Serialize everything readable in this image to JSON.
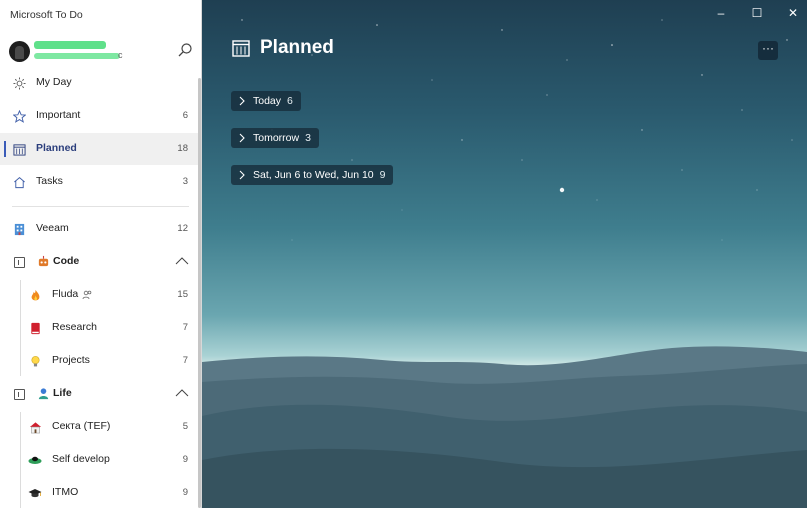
{
  "app": {
    "title": "Microsoft To Do"
  },
  "account": {
    "email_tail": "c"
  },
  "smart_lists": [
    {
      "label": "My Day",
      "count": ""
    },
    {
      "label": "Important",
      "count": "6"
    },
    {
      "label": "Planned",
      "count": "18"
    },
    {
      "label": "Tasks",
      "count": "3"
    }
  ],
  "lists": {
    "veeam": {
      "label": "Veeam",
      "count": "12"
    },
    "code_group": {
      "label": "Code"
    },
    "fluda": {
      "label": "Fluda",
      "count": "15"
    },
    "research": {
      "label": "Research",
      "count": "7"
    },
    "projects": {
      "label": "Projects",
      "count": "7"
    },
    "life_group": {
      "label": "Life"
    },
    "sekta": {
      "label": "Секта (TEF)",
      "count": "5"
    },
    "self_develop": {
      "label": "Self develop",
      "count": "9"
    },
    "itmo": {
      "label": "ITMO",
      "count": "9"
    }
  },
  "main": {
    "title": "Planned",
    "more": "···",
    "groups": [
      {
        "label": "Today",
        "count": "6"
      },
      {
        "label": "Tomorrow",
        "count": "3"
      },
      {
        "label": "Sat, Jun 6 to Wed, Jun 10",
        "count": "9"
      }
    ]
  },
  "window_controls": {
    "minimize": "–",
    "maximize": "☐",
    "close": "✕"
  },
  "colors": {
    "accent": "#3a5bb8",
    "pill_bg": "#162c3a"
  }
}
